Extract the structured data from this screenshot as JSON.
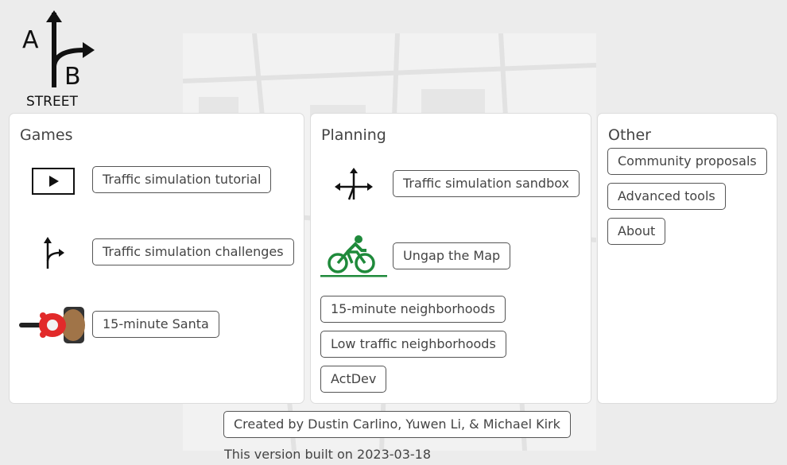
{
  "logo": {
    "letter_a": "A",
    "letter_b": "B",
    "wordmark": "STREET"
  },
  "games": {
    "title": "Games",
    "tutorial": "Traffic simulation tutorial",
    "challenges": "Traffic simulation challenges",
    "santa": "15-minute Santa"
  },
  "planning": {
    "title": "Planning",
    "sandbox": "Traffic simulation sandbox",
    "ungap": "Ungap the Map",
    "fifteen_min": "15-minute neighborhoods",
    "ltn": "Low traffic neighborhoods",
    "actdev": "ActDev"
  },
  "other": {
    "title": "Other",
    "community": "Community proposals",
    "advanced": "Advanced tools",
    "about": "About"
  },
  "footer": {
    "credits": "Created by Dustin Carlino, Yuwen Li, & Michael Kirk",
    "build": "This version built on 2023-03-18"
  },
  "colors": {
    "bike_green": "#1f8a3b",
    "santa_red": "#e22a2a",
    "bag_brown": "#a07448"
  }
}
